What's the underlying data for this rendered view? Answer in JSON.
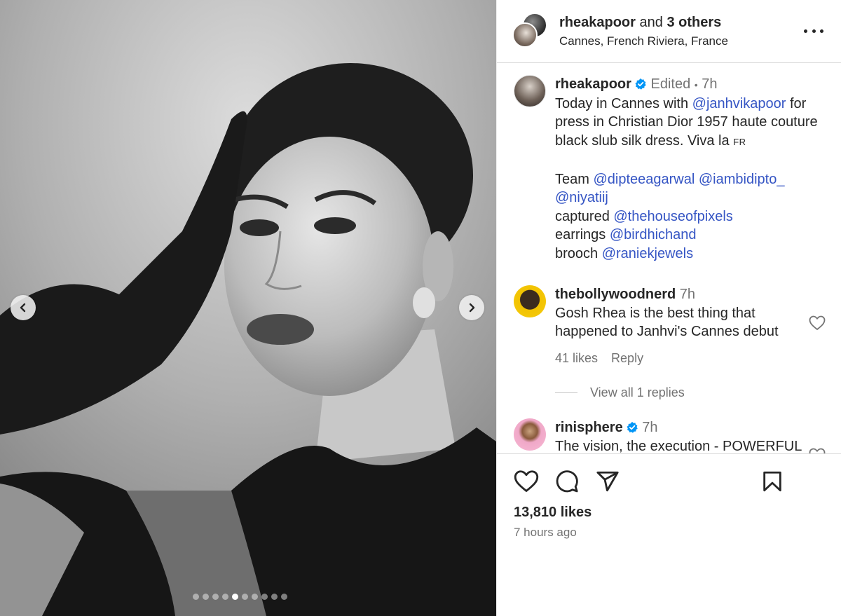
{
  "header": {
    "username": "rheakapoor",
    "and_text": "and",
    "others": "3 others",
    "location": "Cannes, French Riviera, France"
  },
  "caption": {
    "username": "rheakapoor",
    "edited": "Edited",
    "sep": "•",
    "age": "7h",
    "line1_a": "Today in Cannes with ",
    "line1_mention": "@janhvikapoor",
    "line1_b": " for",
    "line2": "press in Christian Dior 1957 haute couture",
    "line3": "black slub silk dress. Viva la ",
    "line3_small": "FR",
    "team_label": "Team ",
    "team_m1": "@dipteeagarwal",
    "team_m2": "@iambidipto_",
    "team_m3": "@niyatiij",
    "captured_label": "captured ",
    "captured_m": "@thehouseofpixels",
    "earrings_label": "earrings ",
    "earrings_m": "@birdhichand",
    "brooch_label": "brooch ",
    "brooch_m": "@raniekjewels"
  },
  "comments": [
    {
      "username": "thebollywoodnerd",
      "age": "7h",
      "line1": "Gosh Rhea is the best thing that",
      "line2": "happened to Janhvi's Cannes debut",
      "likes": "41 likes",
      "reply": "Reply",
      "view_replies": "View all 1 replies"
    },
    {
      "username": "rinisphere",
      "age": "7h",
      "line1": "The vision, the execution - POWERFUL"
    }
  ],
  "footer": {
    "likes": "13,810 likes",
    "time": "7 hours ago"
  },
  "carousel": {
    "total": 10,
    "active_index": 4
  },
  "colors": {
    "link": "#3555c4",
    "verified": "#0095f6",
    "muted": "#737373"
  },
  "icons": [
    "chevron-left-icon",
    "chevron-right-icon",
    "more-icon",
    "verified-icon",
    "heart-icon",
    "comment-icon",
    "share-icon",
    "bookmark-icon"
  ]
}
